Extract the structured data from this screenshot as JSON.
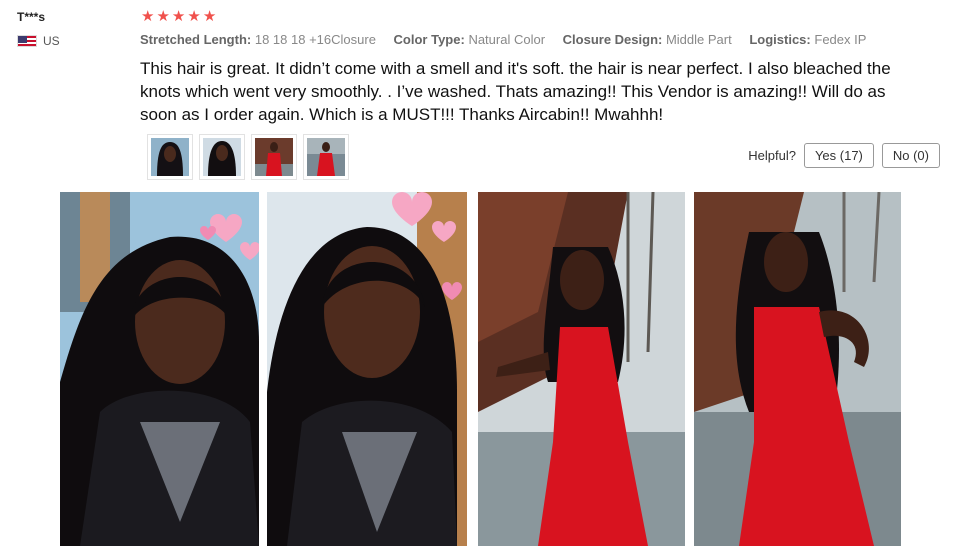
{
  "review": {
    "user": "T***s",
    "country_code": "US",
    "rating": 5,
    "star_glyph": "★",
    "attributes": [
      {
        "label": "Stretched Length:",
        "value": "18 18 18 +16Closure"
      },
      {
        "label": "Color Type:",
        "value": "Natural Color"
      },
      {
        "label": "Closure Design:",
        "value": "Middle Part"
      },
      {
        "label": "Logistics:",
        "value": "Fedex IP"
      }
    ],
    "text": "This hair is great. It didn’t come with a smell and it's soft. the hair is near perfect. I also bleached the knots which went very smoothly. . I’ve washed.  Thats amazing!! This Vendor is amazing!! Will do as soon as I order again. Which is a MUST!!! Thanks Aircabin!! Mwahhh!"
  },
  "helpful": {
    "label": "Helpful?",
    "yes_label": "Yes (17)",
    "no_label": "No (0)"
  },
  "icons": {
    "flag": "us-flag-icon",
    "star": "star-icon"
  },
  "colors": {
    "star": "#f0514c",
    "dress_red": "#d8131f"
  }
}
